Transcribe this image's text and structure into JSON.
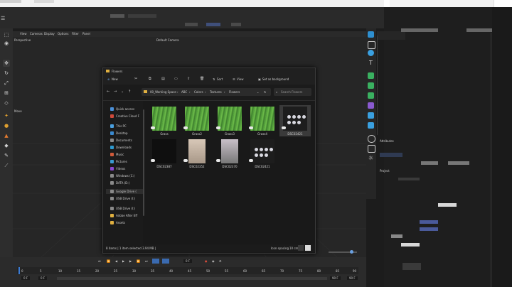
{
  "viewport": {
    "label": "Perspective",
    "camera": "Default Camera",
    "move_label": "Move",
    "menu": [
      "View",
      "Cameras",
      "Display",
      "Options",
      "Filter",
      "Panel"
    ]
  },
  "explorer": {
    "title": "Flowers",
    "cmd": {
      "new": "New",
      "sort": "Sort",
      "view": "View",
      "set_bg": "Set as background"
    },
    "breadcrumb": [
      "00_Working Space",
      "ABC",
      "Colors",
      "Textures",
      "Flowers"
    ],
    "search_placeholder": "Search Flowers",
    "nav": [
      {
        "label": "Quick access",
        "icon": "star-icon",
        "color": "#4a90d9"
      },
      {
        "label": "Creative Cloud F",
        "icon": "cloud-icon",
        "color": "#d04a3a"
      },
      {
        "label": "This PC",
        "icon": "pc-icon",
        "color": "#4aa0e0"
      },
      {
        "label": "Desktop",
        "icon": "desktop-icon",
        "color": "#3a8ad0"
      },
      {
        "label": "Documents",
        "icon": "documents-icon",
        "color": "#8a8a8a"
      },
      {
        "label": "Downloads",
        "icon": "download-icon",
        "color": "#2e9ad0"
      },
      {
        "label": "Music",
        "icon": "music-icon",
        "color": "#d05a3a"
      },
      {
        "label": "Pictures",
        "icon": "pictures-icon",
        "color": "#3a9ad0"
      },
      {
        "label": "Videos",
        "icon": "videos-icon",
        "color": "#8a4ad0"
      },
      {
        "label": "Windows (C:)",
        "icon": "drive-icon",
        "color": "#8a8a8a"
      },
      {
        "label": "DATA (D:)",
        "icon": "drive-icon",
        "color": "#8a8a8a"
      },
      {
        "label": "Google Drive (",
        "icon": "drive-icon",
        "color": "#8a8a8a"
      },
      {
        "label": "USB Drive (I:)",
        "icon": "usb-icon",
        "color": "#8a8a8a"
      },
      {
        "label": "USB Drive (I:)",
        "icon": "usb-icon",
        "color": "#8a8a8a"
      },
      {
        "label": "Adobe After Eff",
        "icon": "folder-icon",
        "color": "#e0b040"
      },
      {
        "label": "Assets",
        "icon": "folder-icon",
        "color": "#e0b040"
      }
    ],
    "files": [
      {
        "name": "Grass",
        "kind": "leaf"
      },
      {
        "name": "Grass2",
        "kind": "leaf"
      },
      {
        "name": "Grass3",
        "kind": "leaf"
      },
      {
        "name": "Grass4",
        "kind": "leaf"
      },
      {
        "name": "DSC02421",
        "kind": "dots"
      },
      {
        "name": "DSC02387",
        "kind": "dark"
      },
      {
        "name": "DSC02352",
        "kind": "room"
      },
      {
        "name": "DSC02370",
        "kind": "room2"
      },
      {
        "name": "DSC02421",
        "kind": "dots"
      }
    ],
    "status": "8 items | 1 item selected 3.94 MB |",
    "status_right": "Icon spacing",
    "status_right_value": "10 cm"
  },
  "timeline": {
    "ticks": [
      "0",
      "5",
      "10",
      "15",
      "20",
      "25",
      "30",
      "35",
      "40",
      "45",
      "50",
      "55",
      "60",
      "65",
      "70",
      "75",
      "80",
      "85",
      "90"
    ],
    "start": "0 F",
    "start2": "0 F",
    "end": "90 F",
    "end2": "90 F",
    "current": "0 F"
  },
  "right_panel": {
    "attributes": "Attributes",
    "project": "Project"
  },
  "colors": {
    "accent": "#3a7bd5",
    "bg": "#1c1c1c"
  }
}
